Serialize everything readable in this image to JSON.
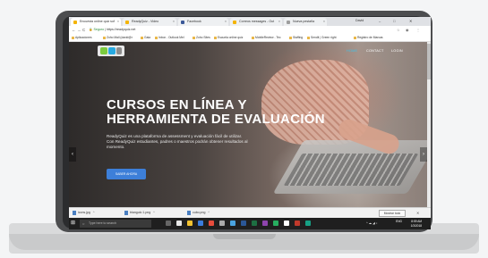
{
  "browser": {
    "tabs": [
      {
        "label": "Encuesta online quiz sof",
        "color": "#f4b400"
      },
      {
        "label": "ReadyQuiz - Video",
        "color": "#f4b400"
      },
      {
        "label": "Facebook",
        "color": "#3b5998"
      },
      {
        "label": "Correos messages - Out",
        "color": "#f4b400"
      },
      {
        "label": "Nueva pestaña",
        "color": "#9e9e9e"
      }
    ],
    "user": "David",
    "window_controls": {
      "minimize": "–",
      "maximize": "□",
      "close": "✕"
    },
    "address": {
      "secure_label": "Seguro",
      "url": "https://readyquiz.net"
    },
    "nav": {
      "back": "←",
      "forward": "→",
      "reload": "C"
    },
    "bookmarks": [
      "Aplicaciones",
      "Zoho Mail (david@r",
      "Gaia",
      "Inbox - Outlook Mel",
      "Zoho Sites",
      "Escuela online quiz",
      "MobileReview - Tec",
      "Staffing",
      "Sendit | Green right",
      "Registro de Marcas"
    ]
  },
  "website": {
    "nav_items": [
      {
        "label": "HOME",
        "active": true
      },
      {
        "label": "CONTACT",
        "active": false
      },
      {
        "label": "LOGIN",
        "active": false
      }
    ],
    "hero": {
      "title": "CURSOS EN LÍNEA Y HERRAMIENTA DE EVALUACIÓN",
      "description": "ReadyQuiz es una plataforma de assessment y evaluación fácil de utilizar. Con ReadyQuiz estudiantes, padres o maestros podrán obtener resultados al momento.",
      "cta_label": "SABER AHORA"
    },
    "carousel": {
      "prev": "‹",
      "next": "›"
    }
  },
  "downloads": {
    "items": [
      "icons.jpg",
      "triangulo 1.png",
      "cubo.png"
    ],
    "show_all": "Mostrar todo",
    "close": "✕"
  },
  "taskbar": {
    "search_placeholder": "Type here to search",
    "language": "ENG",
    "time": "8:59 AM",
    "date": "1/3/2018"
  },
  "colors": {
    "accent": "#3d7fd9",
    "nav_active": "#3fc1e8",
    "laptop_frame": "#4c4d4f"
  }
}
